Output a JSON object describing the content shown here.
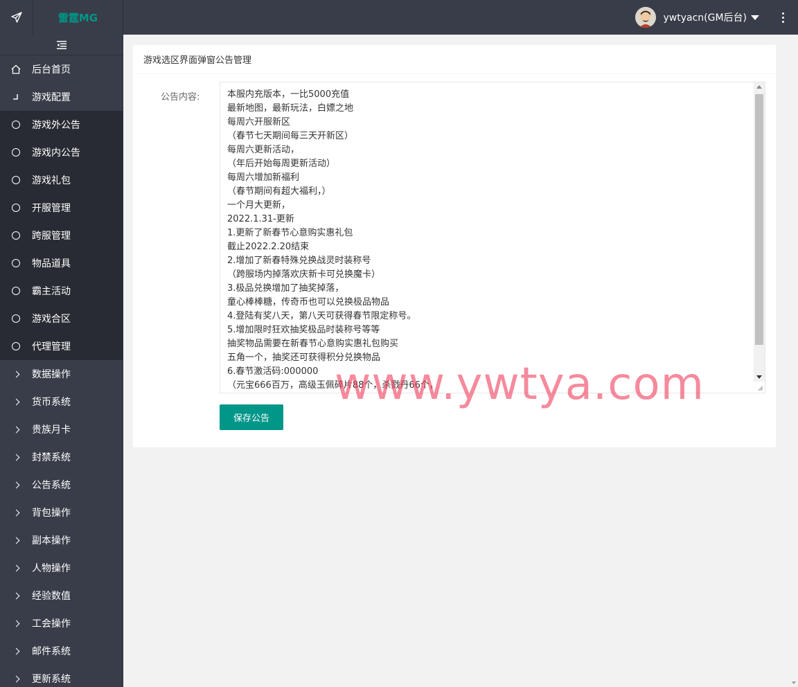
{
  "header": {
    "brand": "雷霆MG",
    "username": "ywtyacn(GM后台)"
  },
  "sidebar": {
    "items": [
      {
        "label": "后台首页",
        "icon": "home-icon",
        "kind": "top"
      },
      {
        "label": "游戏配置",
        "icon": "corner-icon",
        "kind": "top"
      },
      {
        "label": "游戏外公告",
        "icon": "circle-icon",
        "kind": "sub"
      },
      {
        "label": "游戏内公告",
        "icon": "circle-icon",
        "kind": "sub"
      },
      {
        "label": "游戏礼包",
        "icon": "circle-icon",
        "kind": "sub"
      },
      {
        "label": "开服管理",
        "icon": "circle-icon",
        "kind": "sub"
      },
      {
        "label": "跨服管理",
        "icon": "circle-icon",
        "kind": "sub"
      },
      {
        "label": "物品道具",
        "icon": "circle-icon",
        "kind": "sub"
      },
      {
        "label": "霸主活动",
        "icon": "circle-icon",
        "kind": "sub"
      },
      {
        "label": "游戏合区",
        "icon": "circle-icon",
        "kind": "sub"
      },
      {
        "label": "代理管理",
        "icon": "circle-icon",
        "kind": "sub"
      },
      {
        "label": "数据操作",
        "icon": "chevron-right-icon",
        "kind": "grey"
      },
      {
        "label": "货币系统",
        "icon": "chevron-right-icon",
        "kind": "grey"
      },
      {
        "label": "贵族月卡",
        "icon": "chevron-right-icon",
        "kind": "grey"
      },
      {
        "label": "封禁系统",
        "icon": "chevron-right-icon",
        "kind": "grey"
      },
      {
        "label": "公告系统",
        "icon": "chevron-right-icon",
        "kind": "grey"
      },
      {
        "label": "背包操作",
        "icon": "chevron-right-icon",
        "kind": "grey"
      },
      {
        "label": "副本操作",
        "icon": "chevron-right-icon",
        "kind": "grey"
      },
      {
        "label": "人物操作",
        "icon": "chevron-right-icon",
        "kind": "grey"
      },
      {
        "label": "经验数值",
        "icon": "chevron-right-icon",
        "kind": "grey"
      },
      {
        "label": "工会操作",
        "icon": "chevron-right-icon",
        "kind": "grey"
      },
      {
        "label": "邮件系统",
        "icon": "chevron-right-icon",
        "kind": "grey"
      },
      {
        "label": "更新系统",
        "icon": "chevron-right-icon",
        "kind": "grey"
      }
    ]
  },
  "main": {
    "card_title": "游戏选区界面弹窗公告管理",
    "field_label": "公告内容:",
    "textarea_lines": [
      "本服内充版本，一比5000充值",
      "最新地图，最新玩法，白嫖之地",
      "每周六开服新区",
      "（春节七天期间每三天开新区）",
      "每周六更新活动，",
      "（年后开始每周更新活动）",
      "每周六增加新福利",
      "（春节期间有超大福利，）",
      "一个月大更新，",
      "2022.1.31-更新",
      "1.更新了新春节心意购实惠礼包",
      "截止2022.2.20结束",
      "2.增加了新春特殊兑换战灵时装称号",
      "（跨服场内掉落欢庆新卡可兑换魔卡）",
      "3.极品兑换增加了抽奖掉落，",
      "童心棒棒糖，传奇币也可以兑换极品物品",
      "4.登陆有奖八天，第八天可获得春节限定称号。",
      "5.增加限时狂欢抽奖极品时装称号等等",
      "抽奖物品需要在新春节心意购实惠礼包购买",
      "五角一个，抽奖还可获得积分兑换物品",
      "6.春节激活码:000000",
      "（元宝666百万，高级玉佩碎片88个，杀戮丹66个，"
    ],
    "save_label": "保存公告",
    "watermark": "www.ywtya.com",
    "accent_color": "#009688"
  }
}
